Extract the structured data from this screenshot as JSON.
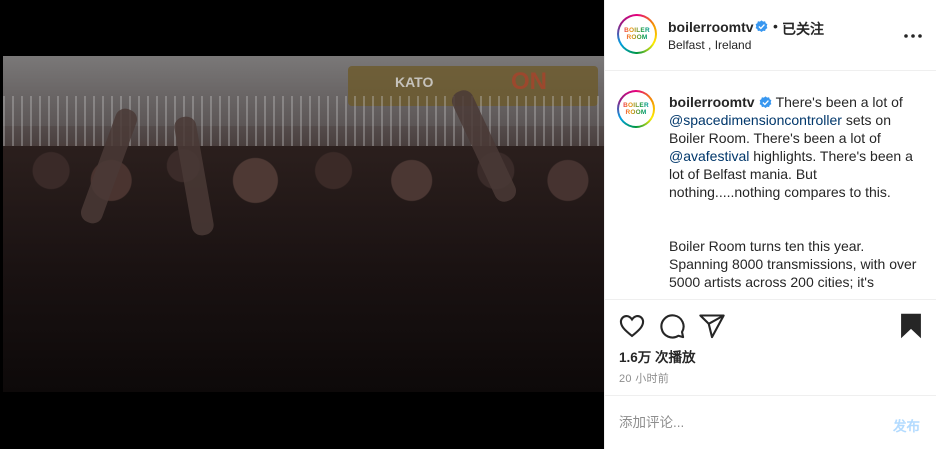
{
  "post": {
    "username": "boilerroomtv",
    "avatar_logo": "BOILER ROOM",
    "follow_status": "已关注",
    "separator": "•",
    "location": "Belfast , Ireland",
    "icons": [
      "more-options-icon",
      "verified-badge-icon",
      "heart-icon",
      "comment-icon",
      "share-icon",
      "bookmark-icon"
    ]
  },
  "caption": {
    "username": "boilerroomtv",
    "p1_part1": "There's been a lot of ",
    "mention1": "@spacedimensioncontroller",
    "p1_part2": " sets on Boiler Room. There's been a lot of ",
    "mention2": "@avafestival",
    "p1_part3": " highlights. There's been a lot of Belfast mania. But nothing.....nothing compares to this.",
    "p2": "Boiler Room turns ten this year. Spanning 8000 transmissions, with over 5000 artists across 200 cities; it's"
  },
  "video": {
    "sign_text": "KATO",
    "sign_text2": "ON"
  },
  "stats": {
    "views": "1.6万 次播放",
    "time": "20 小时前"
  },
  "comment": {
    "placeholder": "添加评论...",
    "post_label": "发布"
  },
  "colors": {
    "mention": "#00376b",
    "post_disabled": "#b3dbff",
    "verified": "#3897f0"
  }
}
